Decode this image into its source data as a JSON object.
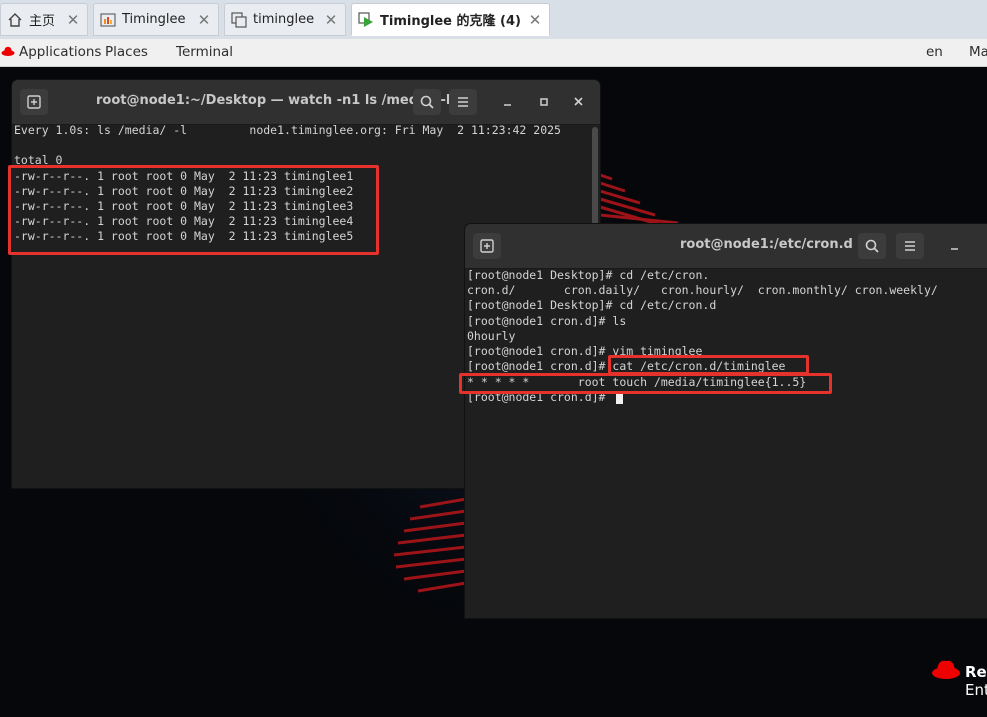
{
  "browser_tabs": [
    {
      "label": "主页",
      "icon": "home-icon"
    },
    {
      "label": "Timinglee",
      "icon": "vm-orange-icon"
    },
    {
      "label": "timinglee",
      "icon": "vm-clone-icon"
    },
    {
      "label": "Timinglee 的克隆 (4)",
      "icon": "vm-running-icon",
      "active": true
    }
  ],
  "gnome_bar": {
    "applications": "Applications",
    "places": "Places",
    "terminal": "Terminal",
    "lang": "en",
    "clock_partial": "Ma"
  },
  "term1": {
    "title": "root@node1:~/Desktop — watch -n1 ls /media/ -l",
    "lines": [
      "Every 1.0s: ls /media/ -l         node1.timinglee.org: Fri May  2 11:23:42 2025",
      "",
      "total 0",
      "-rw-r--r--. 1 root root 0 May  2 11:23 timinglee1",
      "-rw-r--r--. 1 root root 0 May  2 11:23 timinglee2",
      "-rw-r--r--. 1 root root 0 May  2 11:23 timinglee3",
      "-rw-r--r--. 1 root root 0 May  2 11:23 timinglee4",
      "-rw-r--r--. 1 root root 0 May  2 11:23 timinglee5"
    ]
  },
  "term2": {
    "title": "root@node1:/etc/cron.d",
    "lines": [
      "[root@node1 Desktop]# cd /etc/cron.",
      "cron.d/       cron.daily/   cron.hourly/  cron.monthly/ cron.weekly/",
      "[root@node1 Desktop]# cd /etc/cron.d",
      "[root@node1 cron.d]# ls",
      "0hourly",
      "[root@node1 cron.d]# vim timinglee",
      "[root@node1 cron.d]# cat /etc/cron.d/timinglee",
      "* * * * *       root touch /media/timinglee{1..5}",
      "[root@node1 cron.d]# "
    ]
  },
  "brand": {
    "line1": "Re",
    "line2": "Ent"
  },
  "colors": {
    "highlight": "#e5322d",
    "redhat": "#ee0000"
  }
}
